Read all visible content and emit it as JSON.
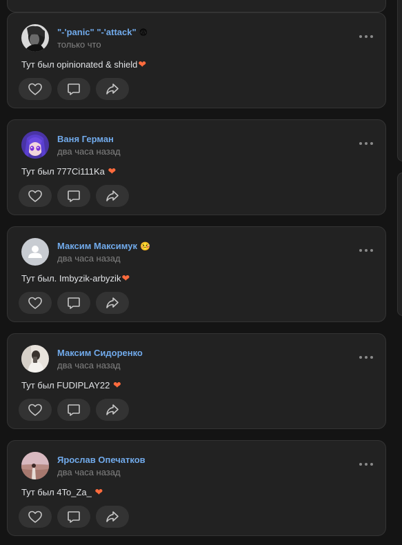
{
  "feed": {
    "heart_glyph": "❤",
    "posts": [
      {
        "author": "\"-'panic\" \"-'attack\"",
        "author_emoji": "😨",
        "time": "только что",
        "text": "Тут был opinionated & shield",
        "avatar": "dark-portrait"
      },
      {
        "author": "Ваня Герман",
        "author_emoji": "",
        "time": "два часа назад",
        "text": "Тут был 777Ci111Ka ",
        "avatar": "anime-girl"
      },
      {
        "author": "Максим Максимук",
        "author_emoji": "🤒",
        "time": "два часа назад",
        "text": "Тут был. Imbyzik-arbyzik",
        "avatar": "default-user"
      },
      {
        "author": "Максим Сидоренко",
        "author_emoji": "",
        "time": "два часа назад",
        "text": "Тут был FUDIPLAY22 ",
        "avatar": "light-photo"
      },
      {
        "author": "Ярослав Опечатков",
        "author_emoji": "",
        "time": "два часа назад",
        "text": "Тут был 4To_Za_ ",
        "avatar": "sunset-photo"
      }
    ]
  },
  "colors": {
    "background": "#141414",
    "card": "#222222",
    "author": "#71aaeb",
    "secondary": "#828282",
    "text": "#e1e3e6",
    "heart": "#ff6b3d"
  },
  "icons": {
    "like": "heart-outline-icon",
    "comment": "comment-bubble-icon",
    "share": "share-arrow-icon",
    "more": "more-dots-icon"
  }
}
